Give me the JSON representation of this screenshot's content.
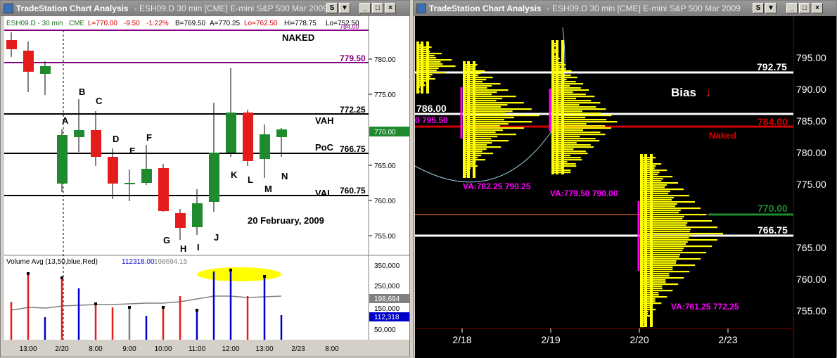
{
  "left_window": {
    "title": "TradeStation Chart Analysis",
    "symbol_text": "- ESH09.D  30 min  [CME] E-mini S&P 500 Mar 2009",
    "buttons": {
      "s1": "S",
      "t1": "▼",
      "min": "_",
      "max": "□",
      "close": "×"
    },
    "status": {
      "symbol": "ESH09.D - 30 min",
      "exchange": "CME",
      "last": "L=770.00",
      "change": "-9.50",
      "pct": "-1.22%",
      "bid": "B=769.50",
      "ask": "A=770.25",
      "low": "Lo=762.50",
      "high": "Hi=778.75",
      "low2": "Lo=752.50",
      "top_cut": "784.00"
    },
    "levels": {
      "naked_label": "NAKED",
      "purple": "779.50",
      "vah_label": "VAH",
      "vah": "772.25",
      "poc_label": "PoC",
      "poc": "766.75",
      "val_label": "VAL",
      "val": "760.75",
      "last_price": "770.00"
    },
    "y_ticks": [
      "780.00",
      "775.00",
      "765.00",
      "760.00",
      "755.00"
    ],
    "date_note": "20 February, 2009",
    "bar_letters": [
      "A",
      "B",
      "C",
      "D",
      "E",
      "F",
      "G",
      "H",
      "I",
      "J",
      "K",
      "L",
      "M",
      "N"
    ],
    "volume": {
      "label": "Volume Avg (13,50,blue,Red)",
      "v1": "112318.00",
      "v2": "198694.15",
      "ticks": [
        "350,000",
        "250,000",
        "150,000",
        "50,000"
      ],
      "tag_avg": "198,694",
      "tag_vol": "112,318"
    },
    "x_ticks": [
      "13:00",
      "2/20",
      "8:00",
      "9:00",
      "10:00",
      "11:00",
      "12:00",
      "13:00",
      "2/23",
      "8:00"
    ]
  },
  "right_window": {
    "title": "TradeStation Chart Analysis",
    "symbol_text": "- ESH09.D  30 min  [CME] E-mini S&P 500 Mar 2009",
    "buttons": {
      "s1": "S",
      "t1": "▼",
      "min": "_",
      "max": "□",
      "close": "×"
    },
    "labels": {
      "l786": "786.00",
      "l795": "0 795.50",
      "va1": "VA:782.25 790.25",
      "va2": "VA:779.50 790.00",
      "va3": "VA:761.25 772.25",
      "bias": "Bias",
      "bias_arrow": "↓",
      "naked": "Naked"
    },
    "levels": {
      "white_top": "792.75",
      "red": "784.00",
      "green": "770.00",
      "white_low": "766.75"
    },
    "y_ticks": [
      "795.00",
      "790.00",
      "785.00",
      "780.00",
      "775.00",
      "765.00",
      "760.00",
      "755.00"
    ],
    "x_ticks": [
      "2/18",
      "2/19",
      "2/20",
      "2/23"
    ]
  },
  "colors": {
    "up": "#1f8a2e",
    "down": "#e51c1c",
    "purple": "#800080",
    "magenta": "#ff00ff",
    "yellow": "#ffff00"
  }
}
